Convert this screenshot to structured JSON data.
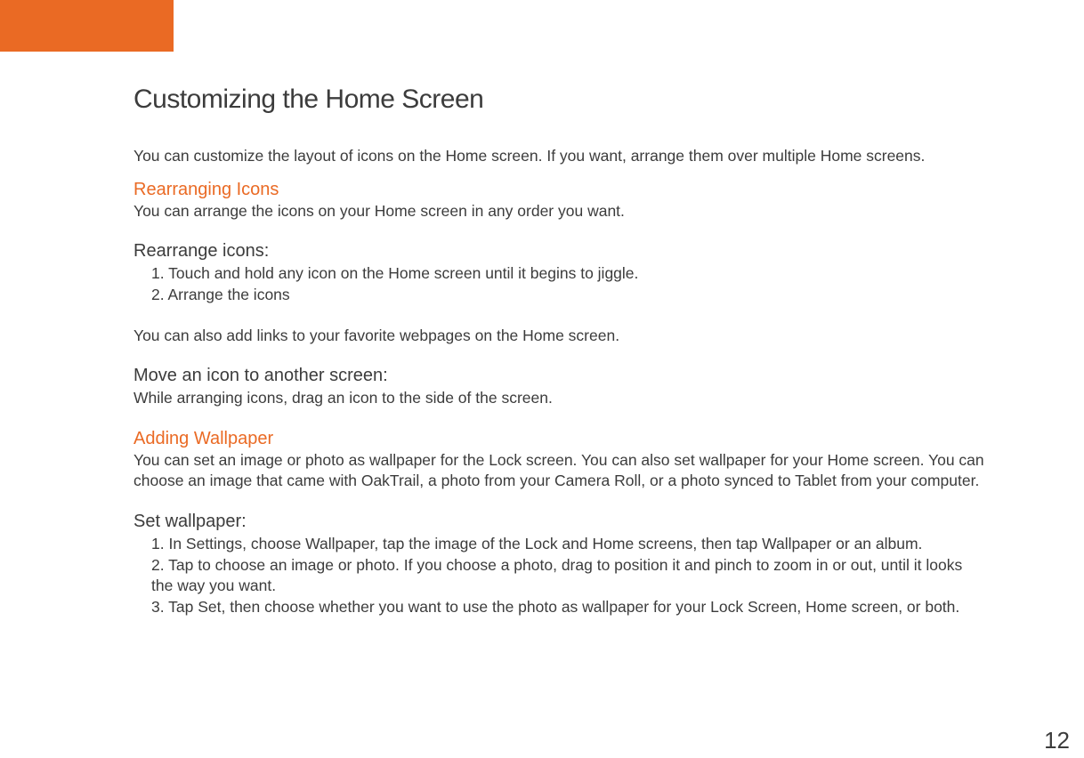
{
  "pageNumber": "12",
  "mainTitle": "Customizing the Home Screen",
  "intro": "You can customize the layout of icons on the Home screen. If you want, arrange them over multiple Home screens.",
  "section1": {
    "heading": "Rearranging Icons",
    "body": "You can arrange the icons on your Home screen in any order you want."
  },
  "rearrange": {
    "heading": "Rearrange icons:",
    "step1": "1. Touch and hold any icon on the Home screen until it begins to jiggle.",
    "step2": "2. Arrange the icons"
  },
  "linksNote": "You can also add links to your favorite webpages on the Home screen.",
  "move": {
    "heading": "Move an icon to another screen:",
    "body": "While arranging icons, drag an icon to the side of the screen."
  },
  "section2": {
    "heading": "Adding Wallpaper",
    "body": "You can set an image or photo as wallpaper for the Lock screen. You can also set wallpaper for your Home screen. You can choose an image that came with OakTrail, a photo from your Camera Roll, or a photo synced to Tablet from your computer."
  },
  "setWallpaper": {
    "heading": "Set wallpaper:",
    "step1": "1. In Settings, choose Wallpaper, tap the image of the Lock and Home screens, then tap Wallpaper or an album.",
    "step2": "2. Tap to choose an image or photo. If you choose a photo, drag to position it and pinch to zoom in or out, until it looks the way you want.",
    "step3": "3. Tap Set, then choose whether you want to use the photo as wallpaper for your Lock Screen, Home screen, or both."
  }
}
